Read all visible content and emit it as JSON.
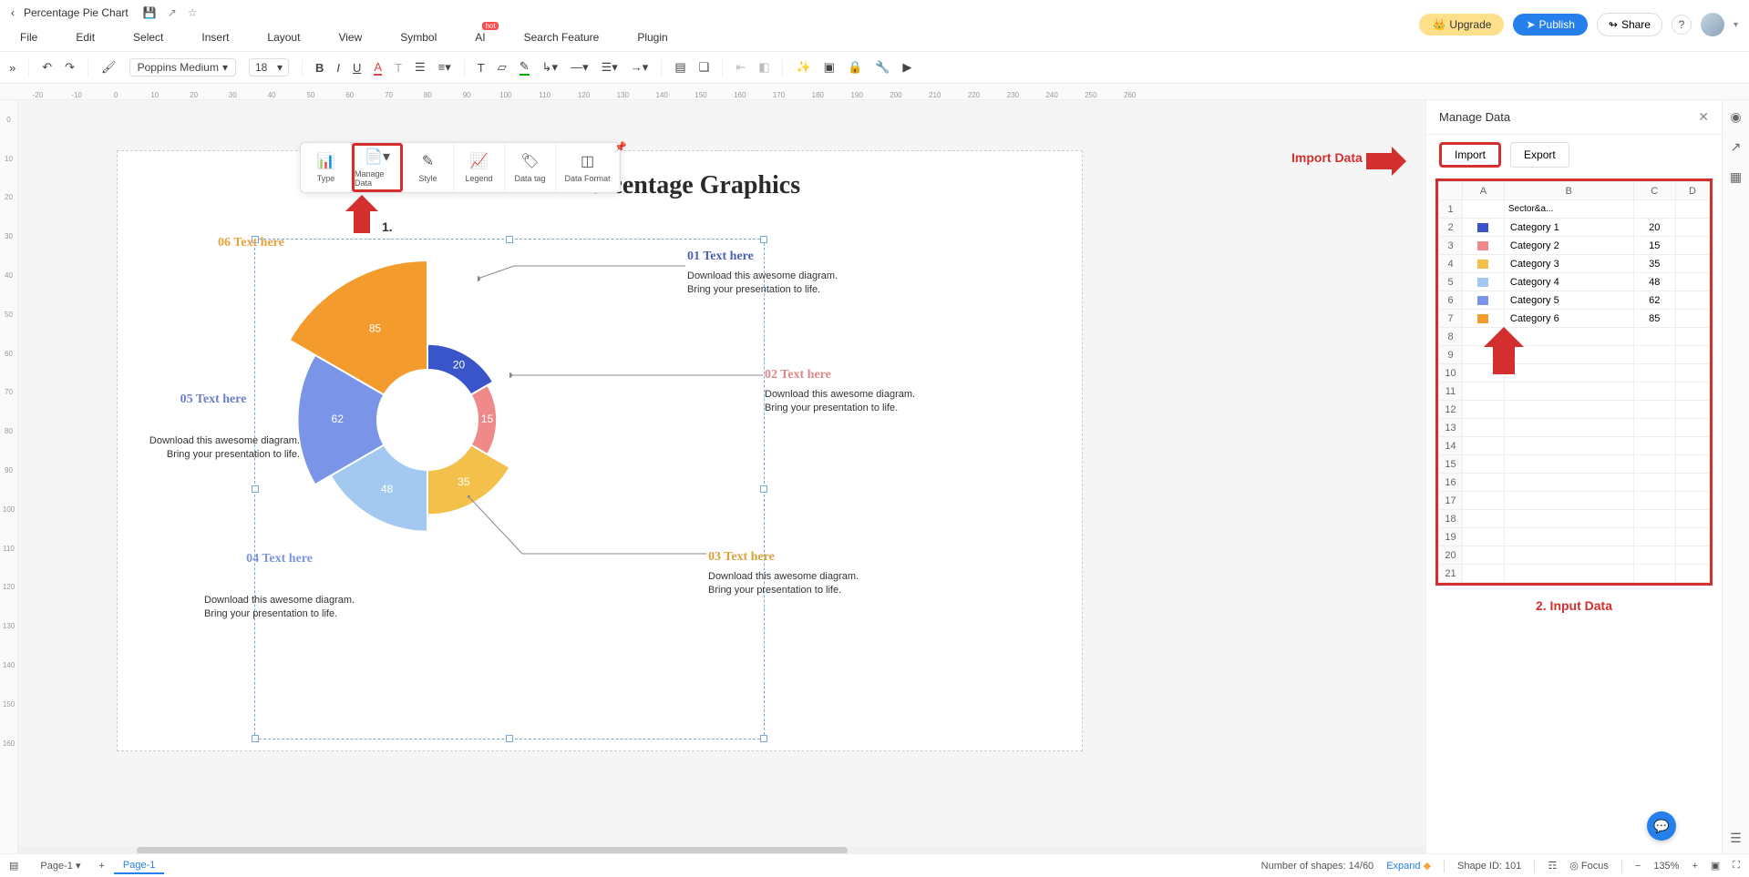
{
  "titlebar": {
    "title": "Percentage Pie Chart"
  },
  "menu": {
    "file": "File",
    "edit": "Edit",
    "select": "Select",
    "insert": "Insert",
    "layout": "Layout",
    "view": "View",
    "symbol": "Symbol",
    "ai": "AI",
    "hot": "hot",
    "search": "Search Feature",
    "plugin": "Plugin"
  },
  "header": {
    "upgrade": "Upgrade",
    "publish": "Publish",
    "share": "Share"
  },
  "toolbar": {
    "font": "Poppins Medium",
    "size": "18"
  },
  "ruler_h": [
    "-20",
    "-10",
    "0",
    "10",
    "20",
    "30",
    "40",
    "50",
    "60",
    "70",
    "80",
    "90",
    "100",
    "110",
    "120",
    "130",
    "140",
    "150",
    "160",
    "170",
    "180",
    "190",
    "200",
    "210",
    "220",
    "230",
    "240",
    "250",
    "260"
  ],
  "ruler_v": [
    "0",
    "10",
    "20",
    "30",
    "40",
    "50",
    "60",
    "70",
    "80",
    "90",
    "100",
    "110",
    "120",
    "130",
    "140",
    "150",
    "160"
  ],
  "chart_toolbar": {
    "type": "Type",
    "manage": "Manage Data",
    "style": "Style",
    "legend": "Legend",
    "datatag": "Data tag",
    "dataformat": "Data Format"
  },
  "annotation": {
    "one": "1.",
    "import": "Import Data",
    "inputdata": "2. Input Data"
  },
  "chart_title": "Percentage Graphics",
  "callouts": {
    "c1": {
      "h": "01 Text here",
      "d1": "Download this awesome diagram.",
      "d2": "Bring your presentation to life."
    },
    "c2": {
      "h": "02 Text here",
      "d1": "Download this awesome diagram.",
      "d2": "Bring your presentation to life."
    },
    "c3": {
      "h": "03 Text here",
      "d1": "Download this awesome diagram.",
      "d2": "Bring your presentation to life."
    },
    "c4": {
      "h": "04 Text here",
      "d1": "Download this awesome diagram.",
      "d2": "Bring your presentation to life."
    },
    "c5": {
      "h": "05 Text here",
      "d1": "Download this awesome diagram.",
      "d2": "Bring your presentation to life."
    },
    "c6": {
      "h": "06 Text here"
    }
  },
  "panel": {
    "title": "Manage Data",
    "import": "Import",
    "export": "Export"
  },
  "grid": {
    "cols": [
      "A",
      "B",
      "C",
      "D"
    ],
    "header_cell": "Sector&a...",
    "rows": [
      {
        "n": "1",
        "label": "",
        "val": ""
      },
      {
        "n": "2",
        "color": "#3a55c9",
        "label": "Category 1",
        "val": "20"
      },
      {
        "n": "3",
        "color": "#f08a8a",
        "label": "Category 2",
        "val": "15"
      },
      {
        "n": "4",
        "color": "#f3c14b",
        "label": "Category 3",
        "val": "35"
      },
      {
        "n": "5",
        "color": "#a4c9f0",
        "label": "Category 4",
        "val": "48"
      },
      {
        "n": "6",
        "color": "#7a95e8",
        "label": "Category 5",
        "val": "62"
      },
      {
        "n": "7",
        "color": "#f39b2d",
        "label": "Category 6",
        "val": "85"
      }
    ],
    "empty_rows": [
      "8",
      "9",
      "10",
      "11",
      "12",
      "13",
      "14",
      "15",
      "16",
      "17",
      "18",
      "19",
      "20",
      "21"
    ]
  },
  "chart_data": {
    "type": "pie",
    "title": "Percentage Graphics",
    "categories": [
      "Category 1",
      "Category 2",
      "Category 3",
      "Category 4",
      "Category 5",
      "Category 6"
    ],
    "values": [
      20,
      15,
      35,
      48,
      62,
      85
    ],
    "colors": [
      "#3a55c9",
      "#f08a8a",
      "#f3c14b",
      "#a4c9f0",
      "#7a95e8",
      "#f39b2d"
    ],
    "labels_on_slices": [
      "20",
      "15",
      "35",
      "48",
      "62",
      "85"
    ],
    "callout_labels": [
      "01 Text here",
      "02 Text here",
      "03 Text here",
      "04 Text here",
      "05 Text here",
      "06 Text here"
    ],
    "note": "Rose/nightingale style — slice radius scales with value; equal angular sectors; donut hole in center"
  },
  "status": {
    "page_select": "Page-1",
    "tab": "Page-1",
    "shapes": "Number of shapes: 14/60",
    "expand": "Expand",
    "shapeid": "Shape ID: 101",
    "focus": "Focus",
    "zoom": "135%"
  }
}
